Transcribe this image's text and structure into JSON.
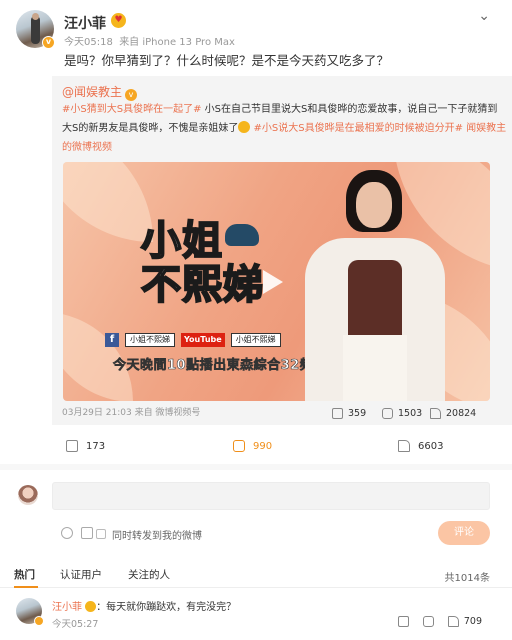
{
  "post": {
    "author": "汪小菲",
    "time": "今天05:18",
    "source": "来自 iPhone 13 Pro Max",
    "text": "是吗？你早猜到了？什么时候呢？是不是今天药又吃多了？",
    "more_icon": "chevron-down-icon"
  },
  "repost": {
    "author": "@闻娱教主",
    "body_tag1": "#小S猜到大S具俊晔在一起了#",
    "body_text1": " 小S在自己节目里说大S和具俊晔的恋爱故事，说自己一下子就猜到大S的新男友是具俊晔，不愧是亲姐妹了",
    "body_tag2": " #小S说大S具俊晔是在最相爱的时候被迫分开#",
    "body_link": " 闻娱教主的微博视频",
    "video": {
      "show_title_line1": "小姐",
      "show_title_line2": "不熙娣",
      "fb_label": "f",
      "fb_name": "小姐不熙娣",
      "yt_label": "YouTube",
      "yt_name": "小姐不熙娣",
      "broadcast_pre": "今天晚間10點",
      "broadcast_hl": "播出",
      "broadcast_post": "東森綜合32頻道"
    },
    "meta": "03月29日 21:03 来自 微博视频号",
    "reposts": "359",
    "comments": "1503",
    "likes": "20824"
  },
  "actions": {
    "repost_count": "173",
    "comment_count": "990",
    "like_count": "6603"
  },
  "composer": {
    "checkbox_label": "同时转发到我的微博",
    "submit_label": "评论"
  },
  "tabs": {
    "hot": "热门",
    "verified": "认证用户",
    "following": "关注的人",
    "total": "共1014条"
  },
  "top_comment": {
    "author": "汪小菲",
    "text": "：每天就你蹦跶欢，有完没完？",
    "time": "今天05:27",
    "likes": "709"
  },
  "colors": {
    "accent": "#eb7350",
    "orange": "#f08f1a",
    "submit_bg": "#fbc5a4"
  }
}
